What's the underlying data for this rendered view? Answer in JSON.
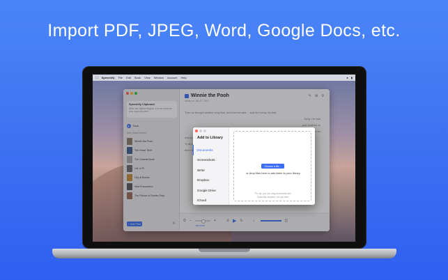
{
  "headline": "Import PDF, JPEG, Word, Google Docs, etc.",
  "menubar": {
    "app_name": "Speechify",
    "items": [
      "File",
      "Edit",
      "Book",
      "View",
      "Window",
      "Account",
      "Help"
    ]
  },
  "sidebar": {
    "clipboard_title": "Speechify Clipboard",
    "clipboard_text": "After the action begins, it is as soon as you copy any text",
    "now_label": "Now",
    "section_label": "Soft | Most Recent",
    "documents": [
      "Winnie the Pooh",
      "The Great Thief",
      "The Canvas Book",
      "Life of Pi",
      "City of Bones",
      "New Encounters",
      "The Picture of Dorian Gray"
    ],
    "add_files_label": "+ Add Files"
  },
  "reader": {
    "title": "Winnie the Pooh",
    "subtitle": "added on Jan 12, 2019",
    "lines": [
      "Then he thought another long time, and then he said: ...and the honey. By that",
      "",
      "",
      "",
      "",
      "",
      "",
      "",
      "Song. He was",
      "",
      ", and crashed on",
      "",
      "",
      "",
      "hough the next six",
      "branches.",
      "\"It all comes, I suppose,\" he decided, as he said good-bye to the last branch, spun round",
      "three times, and flew gracefully into a gorse-bush, \"it all comes of liking honey so much.\""
    ],
    "voice_label": "Joe more"
  },
  "modal": {
    "title": "Add to Library",
    "menu": [
      "Documents",
      "Screenshots",
      "Write",
      "Dropbox",
      "Google Drive",
      "iCloud"
    ],
    "active_index": 0,
    "choose_button": "Choose a file...",
    "drop_text": "or drop files here to add them to your library",
    "pro_tip_line1": "Pro tip: you can drag documents into",
    "pro_tip_line2": "Speechify anytime, not just here."
  },
  "colors": {
    "accent": "#3b6ef2",
    "background_top": "#4a86f7",
    "background_bottom": "#2f5ff0"
  }
}
